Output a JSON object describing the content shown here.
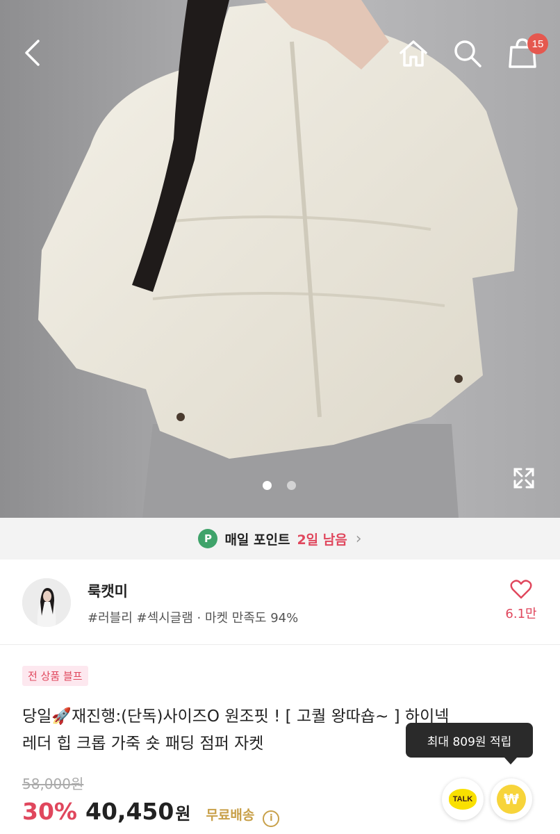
{
  "header": {
    "back_icon": "chevron-left-icon",
    "home_icon": "home-icon",
    "search_icon": "search-icon",
    "cart_icon": "shopping-bag-icon",
    "cart_count": "15",
    "expand_icon": "expand-icon"
  },
  "gallery": {
    "page_count": 2,
    "active_index": 0
  },
  "daily_point": {
    "icon_letter": "P",
    "label": "매일 포인트",
    "remaining": "2일 남음",
    "chevron": "›"
  },
  "shop": {
    "name": "룩캣미",
    "tags": "#러블리 #섹시글램 · 마켓 만족도 94%",
    "like_icon": "heart-icon",
    "like_count": "6.1만"
  },
  "product": {
    "promo_badge": "전 상품 블프",
    "title": "당일🚀재진행:(단독)사이즈O 원조핏 ! [ 고퀄 왕따숍~ ] 하이넥\n레더 힙 크롭 가죽 숏 패딩 점퍼 자켓",
    "original_price": "58,000원",
    "discount": "30%",
    "sale_price": "40,450",
    "currency": "원",
    "shipping": "무료배송",
    "info_icon": "ⓘ"
  },
  "reward_tooltip": "최대 809원 적립",
  "floating": {
    "talk_label": "TALK",
    "points_symbol": "₩"
  },
  "colors": {
    "accent_pink": "#e0475d",
    "point_green": "#3fa36a",
    "shipping_gold": "#c8a049",
    "kakao_yellow": "#f9e000"
  }
}
